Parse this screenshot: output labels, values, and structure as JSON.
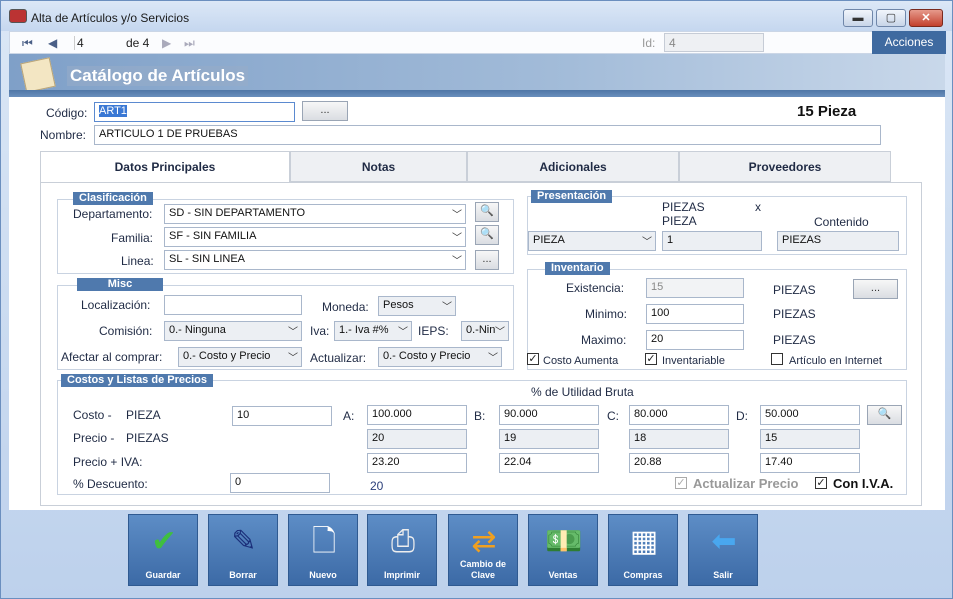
{
  "window": {
    "title": "Alta de Artículos y/o Servicios",
    "min": "▬",
    "max": "▢",
    "close": "✕"
  },
  "nav": {
    "record": "4",
    "of": "de 4",
    "id_label": "Id:",
    "id_value": "4",
    "actions": "Acciones"
  },
  "banner": {
    "title": "Catálogo de Artículos"
  },
  "header": {
    "codigo_label": "Código:",
    "codigo_value": "ART1",
    "browse_btn": "...",
    "stock_summary": "15 Pieza",
    "nombre_label": "Nombre:",
    "nombre_value": "ARTICULO 1 DE PRUEBAS"
  },
  "tabs": [
    {
      "label": "Datos Principales"
    },
    {
      "label": "Notas"
    },
    {
      "label": "Adicionales"
    },
    {
      "label": "Proveedores"
    }
  ],
  "clasificacion": {
    "title": "Clasificación",
    "depto_label": "Departamento:",
    "depto_value": "SD - SIN DEPARTAMENTO",
    "familia_label": "Familia:",
    "familia_value": "SF - SIN FAMILIA",
    "linea_label": "Linea:",
    "linea_value": "SL - SIN LINEA",
    "linea_btn": "..."
  },
  "misc": {
    "title": "Misc",
    "loc_label": "Localización:",
    "loc_value": "",
    "moneda_label": "Moneda:",
    "moneda_value": "Pesos",
    "comision_label": "Comisión:",
    "comision_value": "0.- Ninguna",
    "iva_label": "Iva:",
    "iva_value": "1.- Iva #%",
    "ieps_label": "IEPS:",
    "ieps_value": "0.-Nin",
    "afectar_label": "Afectar al comprar:",
    "afectar_value": "0.- Costo y Precio",
    "actualizar_label": "Actualizar:",
    "actualizar_value": "0.- Costo y Precio"
  },
  "presentacion": {
    "title": "Presentación",
    "unit_top": "PIEZAS",
    "unit_bottom": "PIEZA",
    "times": "x",
    "contenido_label": "Contenido",
    "unit_select": "PIEZA",
    "factor": "1",
    "contenido_value": "PIEZAS"
  },
  "inventario": {
    "title": "Inventario",
    "exist_label": "Existencia:",
    "exist_value": "15",
    "exist_unit": "PIEZAS",
    "exist_btn": "...",
    "min_label": "Minimo:",
    "min_value": "100",
    "min_unit": "PIEZAS",
    "max_label": "Maximo:",
    "max_value": "20",
    "max_unit": "PIEZAS",
    "costo_aumenta": "Costo Aumenta",
    "inventariable": "Inventariable",
    "articulo_internet": "Artículo en Internet",
    "check": "✓"
  },
  "costos": {
    "title": "Costos y Listas de Precios",
    "utilidad_label": "% de Utilidad Bruta",
    "costo_label": "Costo -",
    "costo_unit": "PIEZA",
    "costo_value": "10",
    "precio_label": "Precio -",
    "precio_unit": "PIEZAS",
    "precio_iva_label": "Precio + IVA:",
    "descuento_label": "% Descuento:",
    "descuento_value": "0",
    "descuento_extra": "20",
    "letters": [
      "A:",
      "B:",
      "C:",
      "D:"
    ],
    "util": [
      "100.000",
      "90.000",
      "80.000",
      "50.000"
    ],
    "precio": [
      "20",
      "19",
      "18",
      "15"
    ],
    "precio_iva": [
      "23.20",
      "22.04",
      "20.88",
      "17.40"
    ],
    "actualizar_precio": "Actualizar Precio",
    "con_iva": "Con I.V.A."
  },
  "toolbar": [
    {
      "label": "Guardar"
    },
    {
      "label": "Borrar"
    },
    {
      "label": "Nuevo"
    },
    {
      "label": "Imprimir"
    },
    {
      "label": "Cambio de Clave"
    },
    {
      "label": "Ventas"
    },
    {
      "label": "Compras"
    },
    {
      "label": "Salir"
    }
  ]
}
